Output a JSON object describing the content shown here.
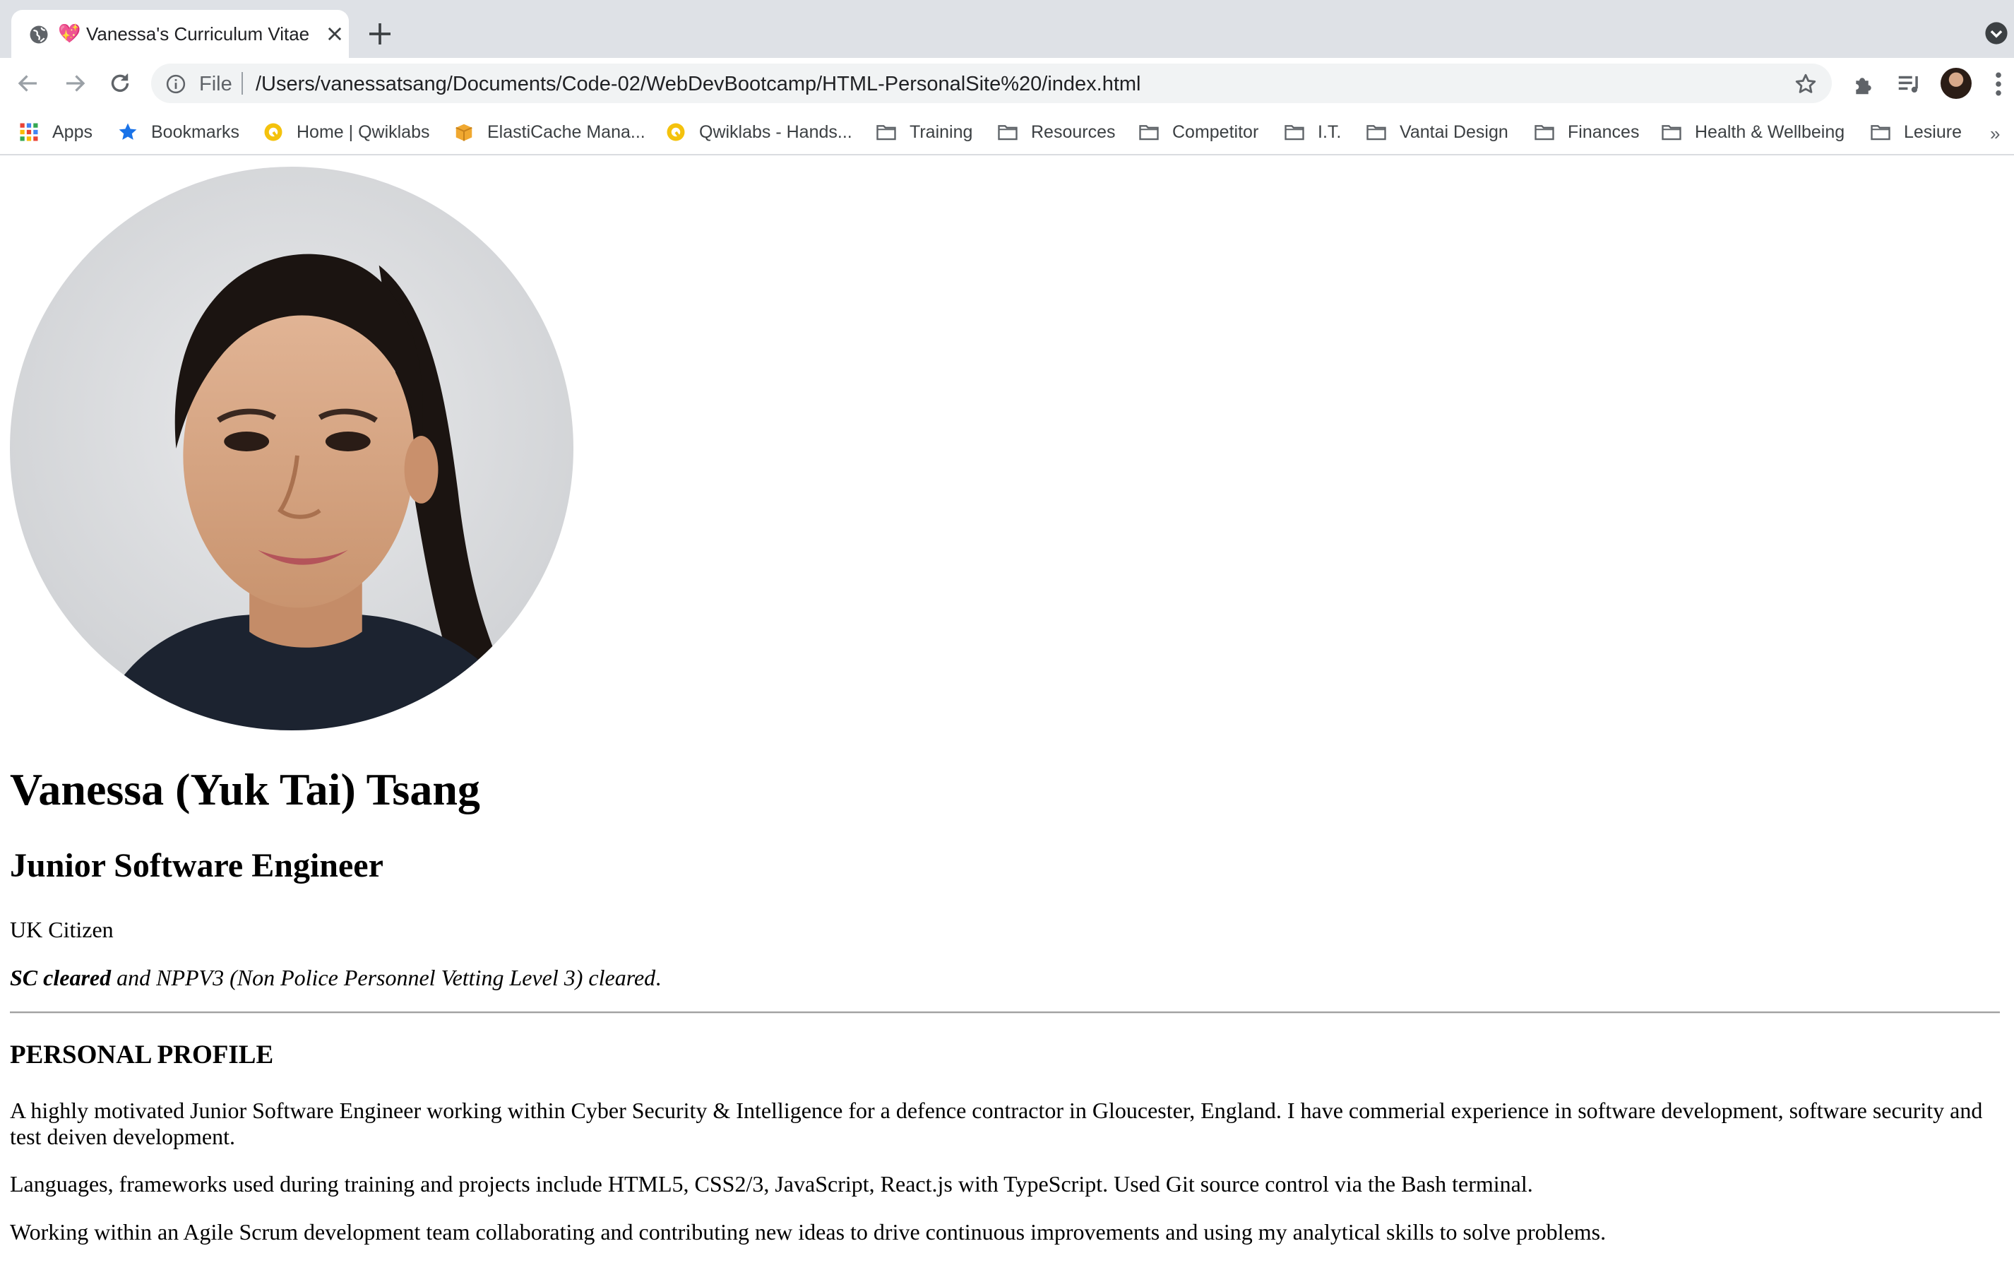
{
  "browser": {
    "tab": {
      "title": "Vanessa's Curriculum Vitae",
      "favicon": "heart-icon"
    },
    "omnibox": {
      "scheme_label": "File",
      "url": "/Users/vanessatsang/Documents/Code-02/WebDevBootcamp/HTML-PersonalSite%20/index.html"
    },
    "bookmarks": [
      {
        "label": "Apps",
        "icon": "apps-grid-icon"
      },
      {
        "label": "Bookmarks",
        "icon": "star-icon"
      },
      {
        "label": "Home | Qwiklabs",
        "icon": "qwiklabs-icon"
      },
      {
        "label": "ElastiCache Mana...",
        "icon": "aws-box-icon"
      },
      {
        "label": "Qwiklabs - Hands...",
        "icon": "qwiklabs-icon"
      },
      {
        "label": "Training",
        "icon": "folder-icon"
      },
      {
        "label": "Resources",
        "icon": "folder-icon"
      },
      {
        "label": "Competitor",
        "icon": "folder-icon"
      },
      {
        "label": "I.T.",
        "icon": "folder-icon"
      },
      {
        "label": "Vantai Design",
        "icon": "folder-icon"
      },
      {
        "label": "Finances",
        "icon": "folder-icon"
      },
      {
        "label": "Health & Wellbeing",
        "icon": "folder-icon"
      },
      {
        "label": "Lesiure",
        "icon": "folder-icon"
      }
    ],
    "bookmarks_overflow": "»"
  },
  "cv": {
    "name": "Vanessa (Yuk Tai) Tsang",
    "role": "Junior Software Engineer",
    "citizenship": "UK Citizen",
    "clearance_bold": "SC cleared",
    "clearance_rest": " and NPPV3 (Non Police Personnel Vetting Level 3) cleared",
    "clearance_end": ".",
    "section_title": "PERSONAL PROFILE",
    "paragraphs": [
      "A highly motivated Junior Software Engineer working within Cyber Security & Intelligence for a defence contractor in Gloucester, England. I have commerial experience in software development, software security and test deiven development.",
      "Languages, frameworks used during training and projects include HTML5, CSS2/3, JavaScript, React.js with TypeScript. Used Git source control via the Bash terminal.",
      "Working within an Agile Scrum development team collaborating and contributing new ideas to drive continuous improvements and using my analytical skills to solve problems."
    ]
  },
  "colors": {
    "tabstrip_bg": "#dee1e6",
    "omnibox_bg": "#f1f3f4",
    "folder_icon": "#5f6368",
    "star_accent": "#1a73e8",
    "qwiklabs_accent": "#f4c20d"
  }
}
